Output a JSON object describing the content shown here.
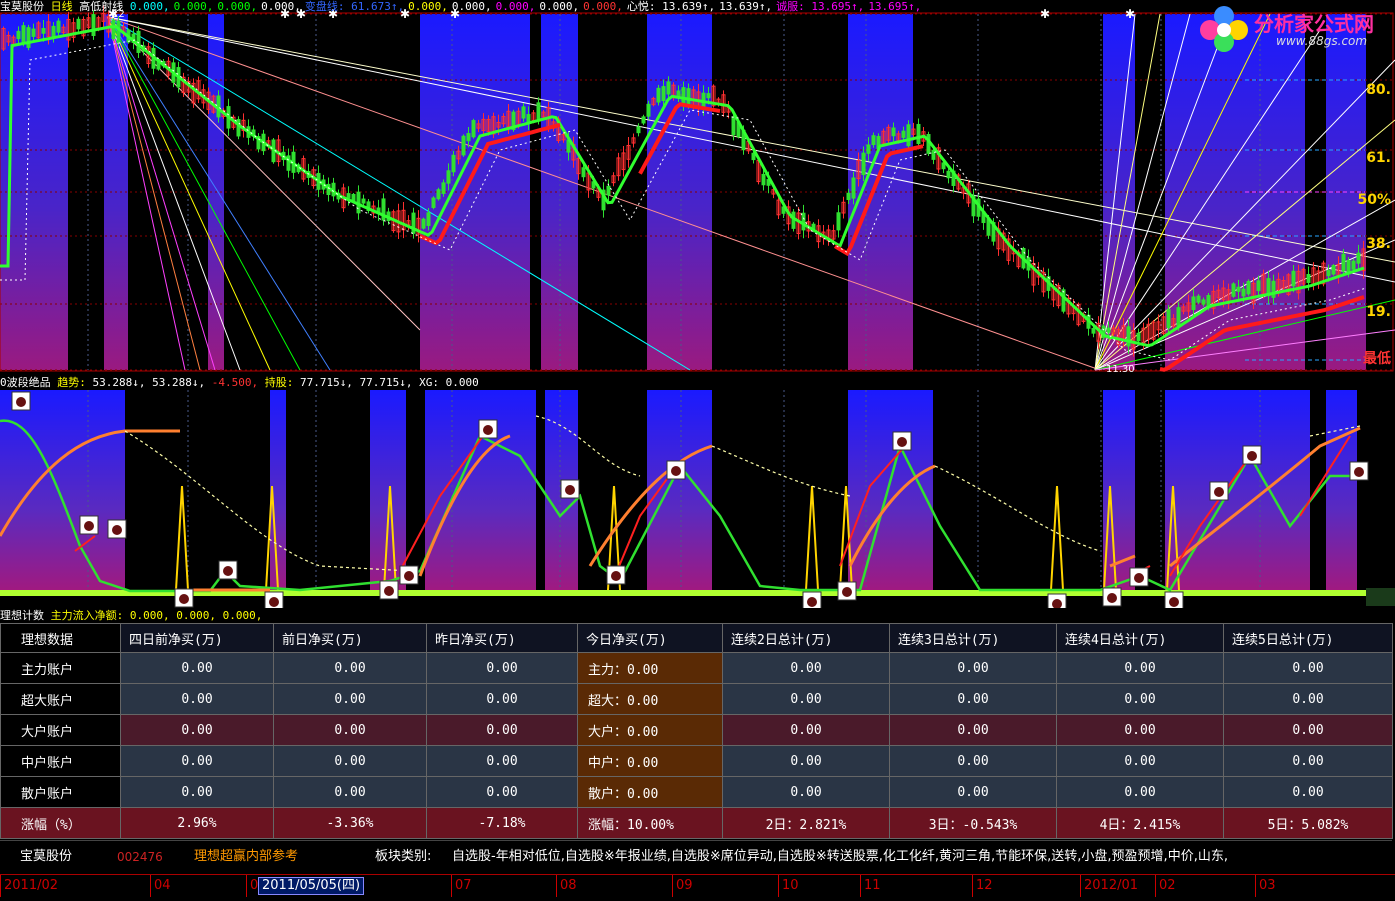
{
  "main": {
    "stock_name": "宝莫股份",
    "period": "日线",
    "indicator": "高低射线",
    "values": [
      {
        "text": "0.000,",
        "color": "cyan"
      },
      {
        "text": "0.000,",
        "color": "green"
      },
      {
        "text": "0.000,",
        "color": "green"
      },
      {
        "text": "0.000,",
        "color": "white"
      },
      {
        "text": "变盘线: 61.673↑,",
        "color": "blue"
      },
      {
        "text": "0.000,",
        "color": "yellow"
      },
      {
        "text": "0.000,",
        "color": "white"
      },
      {
        "text": "0.000,",
        "color": "magenta"
      },
      {
        "text": "0.000,",
        "color": "white"
      },
      {
        "text": "0.000,",
        "color": "red"
      },
      {
        "text": "心悦: 13.639↑,",
        "color": "white"
      },
      {
        "text": "13.639↑,",
        "color": "white"
      },
      {
        "text": "诚服: 13.695↑,",
        "color": "magenta"
      },
      {
        "text": "13.695↑,",
        "color": "magenta"
      }
    ],
    "price_labels": {
      "high": "12",
      "low": "11.30"
    },
    "fib_labels": [
      "80.",
      "61.",
      "50%",
      "38.",
      "19.",
      "最低"
    ]
  },
  "logo": {
    "text": "分析家公式网",
    "url": "www.88gs.com"
  },
  "indicator_panel": {
    "name": "0波段绝品",
    "trend_label": "趋势:",
    "trend_values": [
      "53.288↓,",
      "53.288↓,",
      "-4.500,"
    ],
    "hold_label": "持股:",
    "hold_values": [
      "77.715↓,",
      "77.715↓,"
    ],
    "xg": "XG: 0.000"
  },
  "table_title": {
    "name": "理想计数",
    "flow": "主力流入净额: 0.000, 0.000, 0.000,"
  },
  "table": {
    "corner": "理想数据",
    "headers": [
      "四日前净买(万)",
      "前日净买(万)",
      "昨日净买(万)",
      "今日净买(万)",
      "连续2日总计(万)",
      "连续3日总计(万)",
      "连续4日总计(万)",
      "连续5日总计(万)"
    ],
    "rows": [
      {
        "label": "主力账户",
        "cells": [
          "0.00",
          "0.00",
          "0.00",
          "主力：0.00",
          "0.00",
          "0.00",
          "0.00",
          "0.00"
        ]
      },
      {
        "label": "超大账户",
        "cells": [
          "0.00",
          "0.00",
          "0.00",
          "超大：0.00",
          "0.00",
          "0.00",
          "0.00",
          "0.00"
        ]
      },
      {
        "label": "大户账户",
        "cells": [
          "0.00",
          "0.00",
          "0.00",
          "大户：0.00",
          "0.00",
          "0.00",
          "0.00",
          "0.00"
        ]
      },
      {
        "label": "中户账户",
        "cells": [
          "0.00",
          "0.00",
          "0.00",
          "中户：0.00",
          "0.00",
          "0.00",
          "0.00",
          "0.00"
        ]
      },
      {
        "label": "散户账户",
        "cells": [
          "0.00",
          "0.00",
          "0.00",
          "散户：0.00",
          "0.00",
          "0.00",
          "0.00",
          "0.00"
        ]
      },
      {
        "label": "涨幅（%）",
        "cells": [
          "2.96%",
          "-3.36%",
          "-7.18%",
          "涨幅：10.00%",
          "2日：2.821%",
          "3日：-0.543%",
          "4日：2.415%",
          "5日：5.082%"
        ]
      }
    ]
  },
  "footer": {
    "stock_name": "宝莫股份",
    "stock_code": "002476",
    "reference": "理想超赢内部参考",
    "sector_label": "板块类别:",
    "sectors": "自选股-年相对低位,自选股※年报业绩,自选股※席位异动,自选股※转送股票,化工化纤,黄河三角,节能环保,送转,小盘,预盈预增,中价,山东,"
  },
  "date_axis": {
    "ticks": [
      "2011/02",
      "04",
      "0",
      "07",
      "08",
      "09",
      "10",
      "11",
      "12",
      "2012/01",
      "02",
      "03"
    ],
    "cursor": "2011/05/05(四)"
  }
}
